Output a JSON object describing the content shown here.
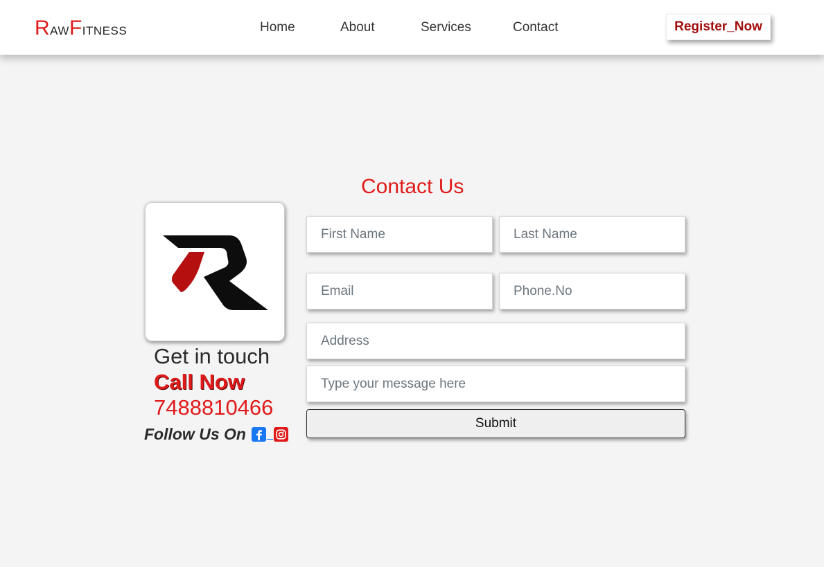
{
  "header": {
    "logo_first_letter": "R",
    "logo_part1": "aw",
    "logo_second_letter": "F",
    "logo_part2": "itness",
    "nav": [
      "Home",
      "About",
      "Services",
      "Contact"
    ],
    "register_label": "Register_Now"
  },
  "contact": {
    "title": "Contact Us",
    "get_in_touch": "Get in touch",
    "call_now": "Call Now",
    "phone": "7488810466",
    "follow_label": "Follow Us On",
    "social_separator": "_",
    "social_icons": [
      "facebook-icon",
      "instagram-icon"
    ]
  },
  "form": {
    "first_name_placeholder": "First Name",
    "last_name_placeholder": "Last Name",
    "email_placeholder": "Email",
    "phone_placeholder": "Phone.No",
    "address_placeholder": "Address",
    "message_placeholder": "Type your message here",
    "submit_label": "Submit"
  },
  "colors": {
    "accent_red": "#e01a1a",
    "register_red": "#a30d0d",
    "facebook_blue": "#1877f2",
    "background": "#f4f4f4"
  }
}
